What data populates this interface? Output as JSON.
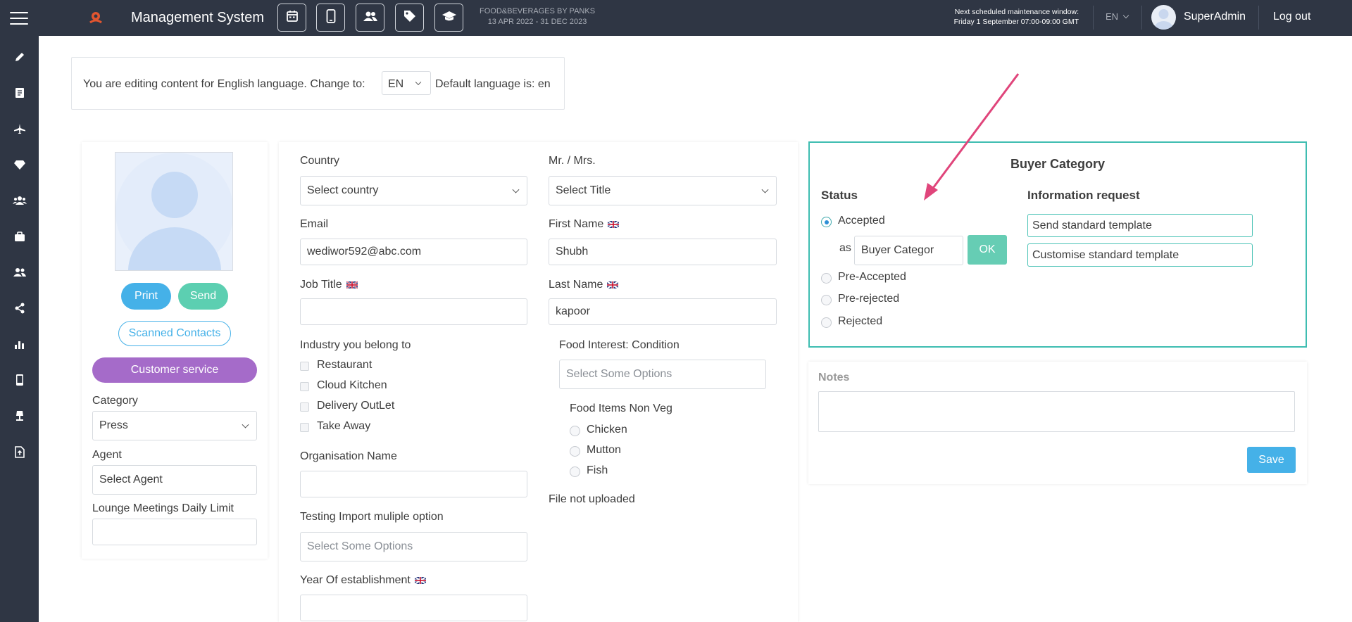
{
  "header": {
    "app_title": "Management System",
    "event_name": "FOOD&BEVERAGES BY PANKS",
    "event_dates": "13 APR 2022 - 31 DEC 2023",
    "maintenance_label": "Next scheduled maintenance window:",
    "maintenance_time": "Friday 1 September 07:00-09:00 GMT",
    "language": "EN",
    "username": "SuperAdmin",
    "logout": "Log out",
    "toolbar_icons": [
      "calendar-icon",
      "mobile-icon",
      "users-icon",
      "tag-icon",
      "graduation-cap-icon"
    ]
  },
  "sidebar": {
    "icons": [
      "pencil-icon",
      "document-icon",
      "plane-icon",
      "diamond-icon",
      "group-icon",
      "briefcase-icon",
      "people-icon",
      "share-icon",
      "bar-chart-icon",
      "mobile-icon",
      "lamp-icon",
      "file-upload-icon"
    ]
  },
  "language_notice": {
    "text": "You are editing content for English language. Change to:",
    "selected": "EN",
    "default_text": "Default language is: en"
  },
  "profile": {
    "print_label": "Print",
    "send_label": "Send",
    "scanned_contacts_label": "Scanned Contacts",
    "customer_service_label": "Customer service",
    "category_label": "Category",
    "category_value": "Press",
    "agent_label": "Agent",
    "agent_placeholder": "Select Agent",
    "lounge_label": "Lounge Meetings Daily Limit",
    "lounge_value": ""
  },
  "form": {
    "country_label": "Country",
    "country_placeholder": "Select country",
    "title_label": "Mr. / Mrs.",
    "title_placeholder": "Select Title",
    "email_label": "Email",
    "email_value": "wediwor592@abc.com",
    "first_name_label": "First Name",
    "first_name_value": "Shubh",
    "job_title_label": "Job Title",
    "job_title_value": "",
    "last_name_label": "Last Name",
    "last_name_value": "kapoor",
    "industry_label": "Industry you belong to",
    "industry_options": [
      "Restaurant",
      "Cloud Kitchen",
      "Delivery OutLet",
      "Take Away"
    ],
    "food_interest_label": "Food Interest: Condition",
    "food_interest_placeholder": "Select Some Options",
    "food_items_label": "Food Items Non Veg",
    "food_items_options": [
      "Chicken",
      "Mutton",
      "Fish"
    ],
    "organisation_label": "Organisation Name",
    "organisation_value": "",
    "file_status": "File not uploaded",
    "testing_import_label": "Testing Import muliple option",
    "testing_import_placeholder": "Select Some Options",
    "year_label": "Year Of establishment",
    "year_value": ""
  },
  "buyer_category": {
    "title": "Buyer Category",
    "status_label": "Status",
    "info_label": "Information request",
    "statuses": [
      "Accepted",
      "Pre-Accepted",
      "Pre-rejected",
      "Rejected"
    ],
    "selected_status": "Accepted",
    "as_label": "as",
    "as_value": "Buyer Categor",
    "ok_label": "OK",
    "info_options": [
      "Send standard template",
      "Customise standard template"
    ]
  },
  "notes": {
    "label": "Notes",
    "value": "",
    "save_label": "Save"
  },
  "colors": {
    "topbar": "#2f3644",
    "accent_blue": "#45b1e8",
    "accent_teal": "#5ccfb1",
    "customer_service": "#a56bc9",
    "buyer_border": "#3ebdb1",
    "annotation_arrow": "#e0457b"
  }
}
